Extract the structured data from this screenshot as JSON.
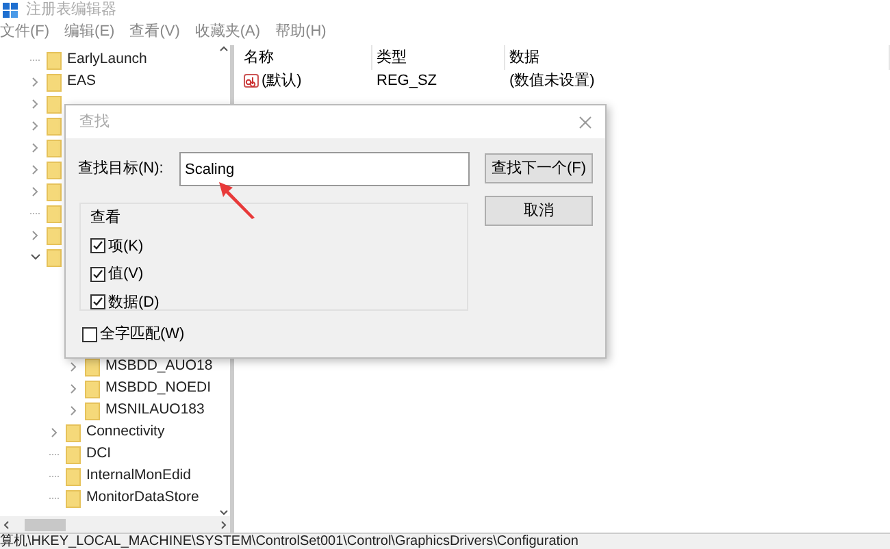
{
  "window": {
    "title": "注册表编辑器"
  },
  "menu": [
    {
      "label": "文件(F)"
    },
    {
      "label": "编辑(E)"
    },
    {
      "label": "查看(V)"
    },
    {
      "label": "收藏夹(A)"
    },
    {
      "label": "帮助(H)"
    }
  ],
  "tree": [
    {
      "label": "EarlyLaunch",
      "expandable": false
    },
    {
      "label": "EAS",
      "expandable": true,
      "expanded": false
    },
    {
      "expandable": true,
      "expanded": false
    },
    {
      "expandable": true,
      "expanded": false
    },
    {
      "expandable": true,
      "expanded": false
    },
    {
      "expandable": true,
      "expanded": false
    },
    {
      "expandable": true,
      "expanded": false
    },
    {
      "expandable": false
    },
    {
      "expandable": true,
      "expanded": false
    },
    {
      "expandable": true,
      "expanded": true,
      "children": [
        {
          "children": [
            {
              "label": "MSBDD_AUO18",
              "expandable": true,
              "expanded": false
            },
            {
              "label": "MSBDD_NOEDI",
              "expandable": true,
              "expanded": false
            },
            {
              "label": "MSNILAUO183",
              "expandable": true,
              "expanded": false
            }
          ]
        },
        {
          "label": "Connectivity",
          "expandable": true,
          "expanded": false
        },
        {
          "label": "DCI",
          "expandable": false
        },
        {
          "label": "InternalMonEdid",
          "expandable": false
        },
        {
          "label": "MonitorDataStore",
          "expandable": false
        }
      ]
    }
  ],
  "list": {
    "columns": [
      "名称",
      "类型",
      "数据"
    ],
    "rows": [
      {
        "name": "(默认)",
        "type": "REG_SZ",
        "data": "(数值未设置)"
      }
    ]
  },
  "status_bar": "算机\\HKEY_LOCAL_MACHINE\\SYSTEM\\ControlSet001\\Control\\GraphicsDrivers\\Configuration",
  "dialog": {
    "title": "查找",
    "target_label": "查找目标(N):",
    "target_value": "Scaling",
    "group_title": "查看",
    "options": [
      {
        "label": "项(K)",
        "checked": true
      },
      {
        "label": "值(V)",
        "checked": true
      },
      {
        "label": "数据(D)",
        "checked": true
      }
    ],
    "whole_word": {
      "label": "全字匹配(W)",
      "checked": false
    },
    "buttons": [
      {
        "label": "查找下一个(F)"
      },
      {
        "label": "取消"
      }
    ]
  }
}
